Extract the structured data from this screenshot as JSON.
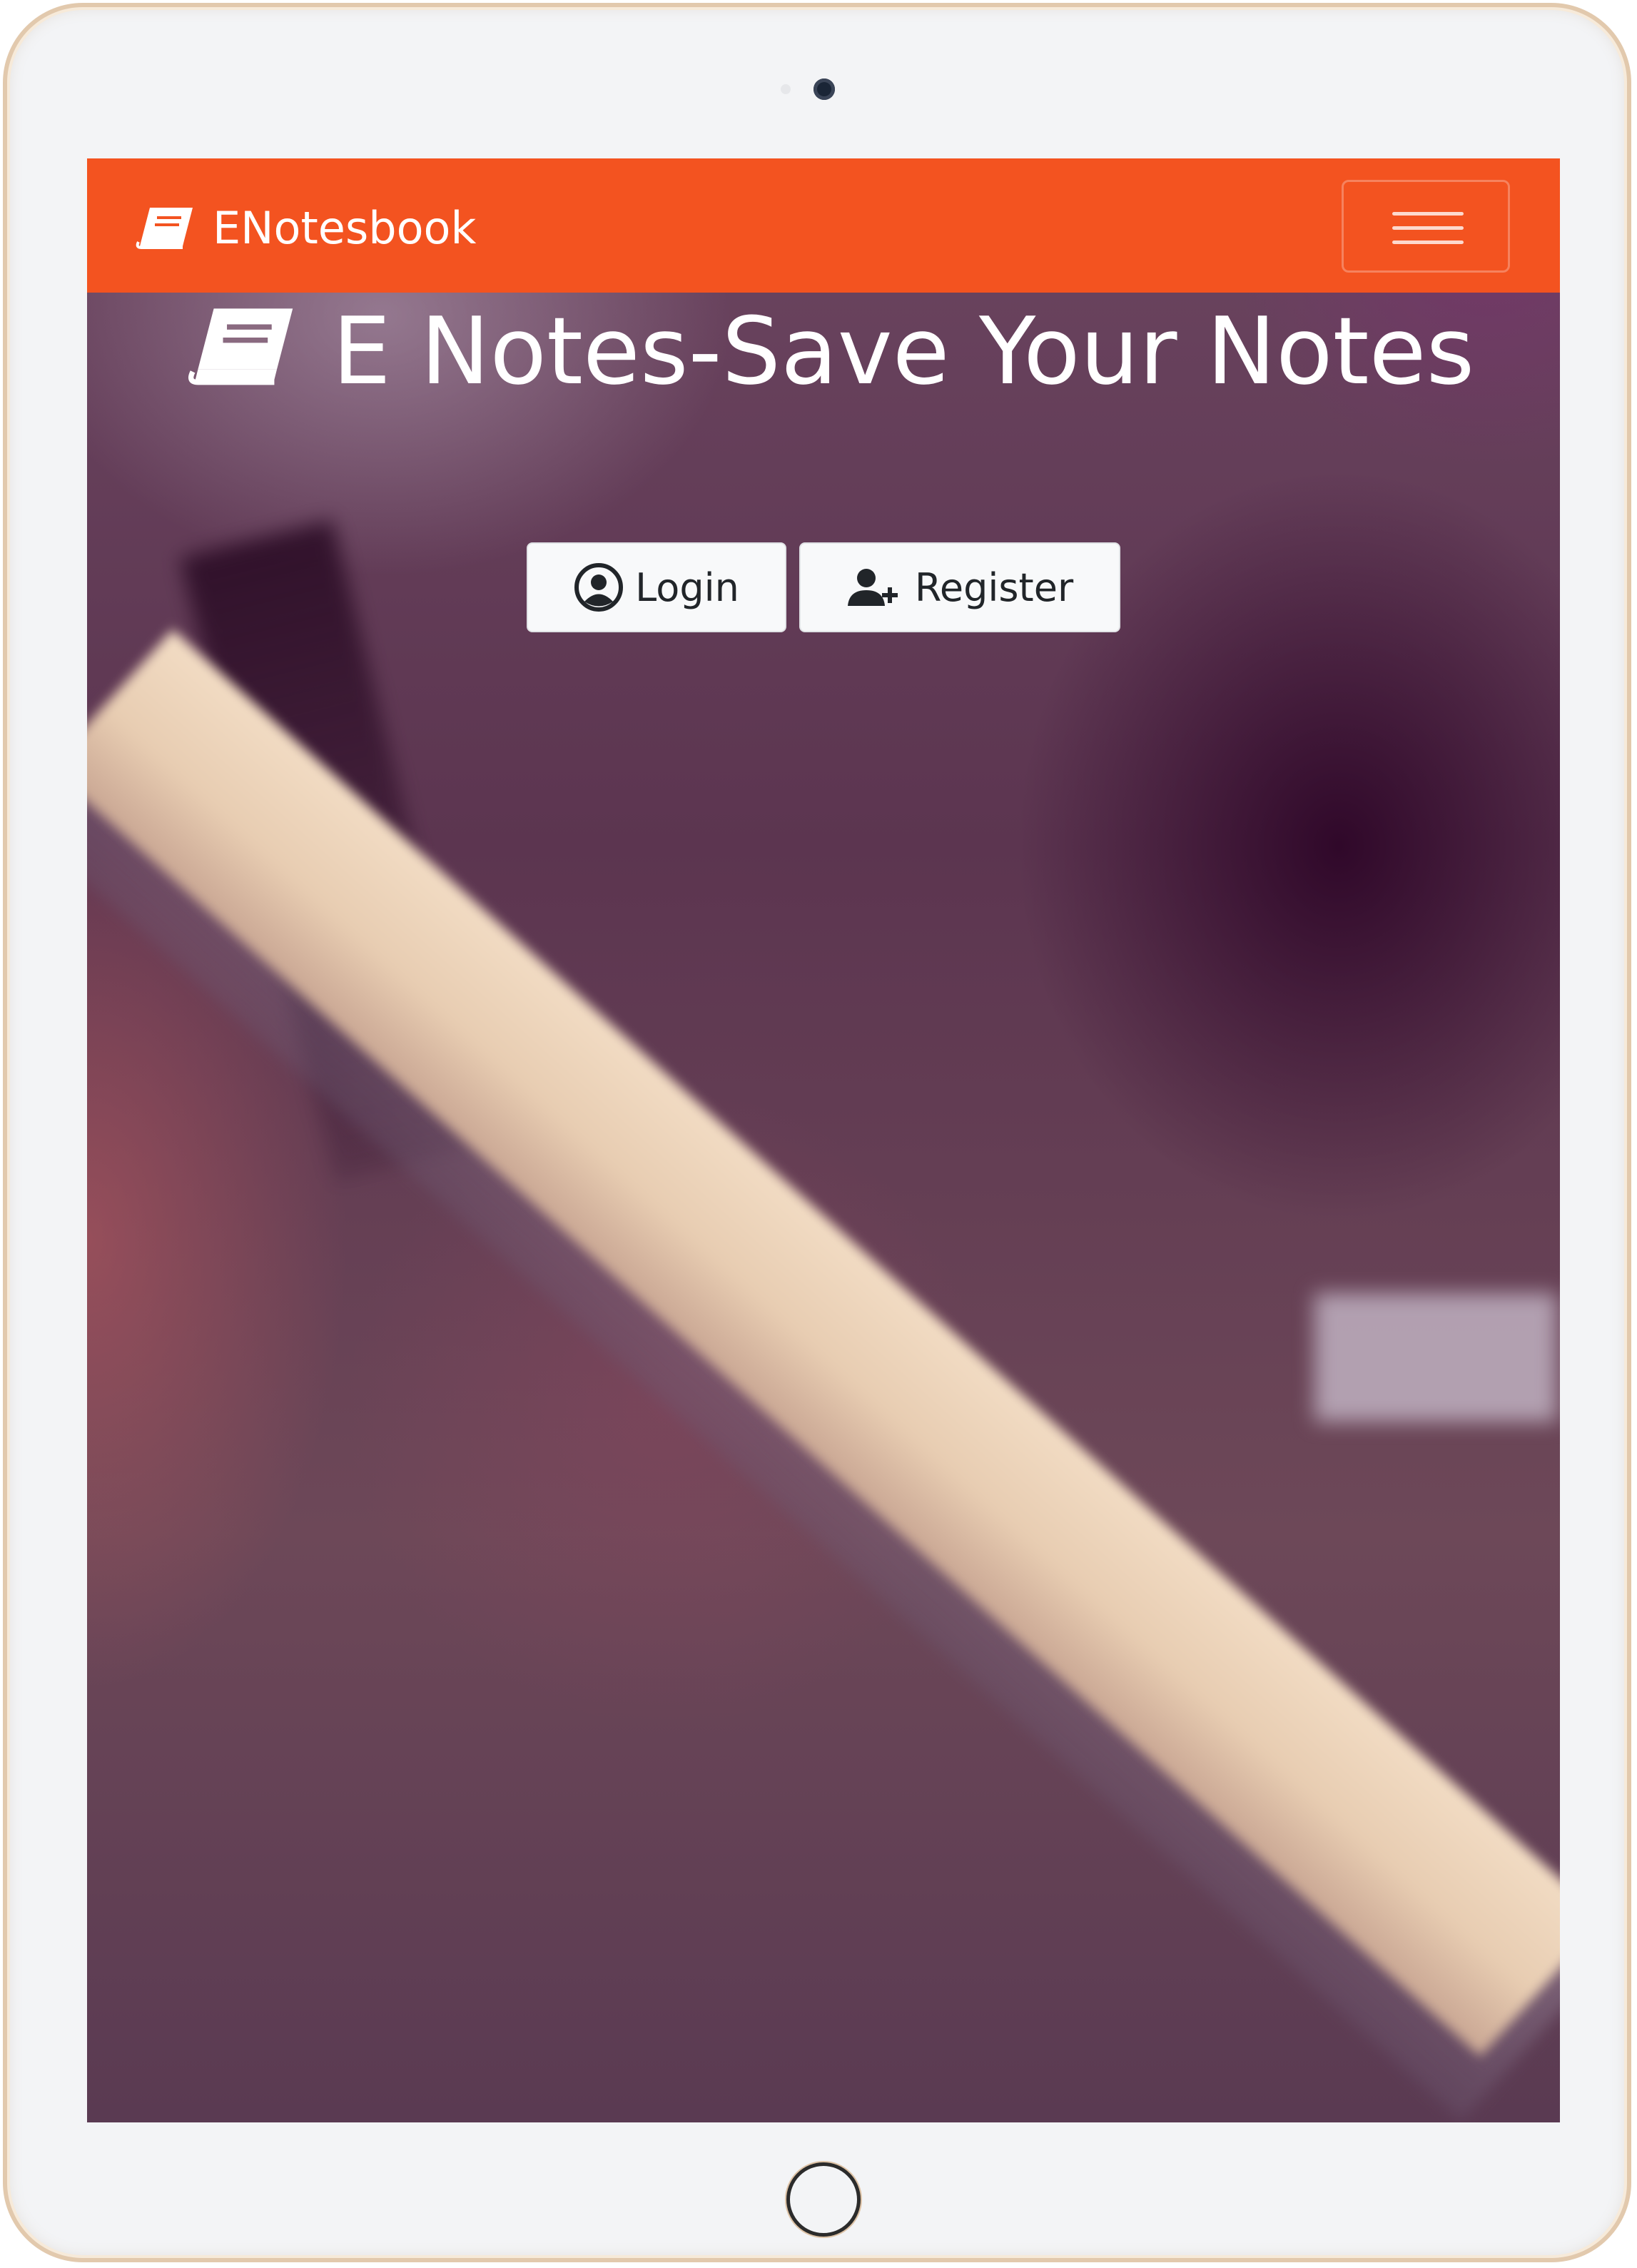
{
  "navbar": {
    "brand": "ENotesbook",
    "brand_icon": "book-icon",
    "toggler_icon": "hamburger-menu-icon",
    "background_color": "#f35320"
  },
  "hero": {
    "title": "E Notes-Save Your Notes",
    "title_icon": "book-icon",
    "buttons": [
      {
        "label": "Login",
        "icon": "user-circle-icon"
      },
      {
        "label": "Register",
        "icon": "user-plus-icon"
      }
    ]
  },
  "device": {
    "frame_color": "#e2c9ad",
    "bezel_color": "#f3f4f6"
  }
}
